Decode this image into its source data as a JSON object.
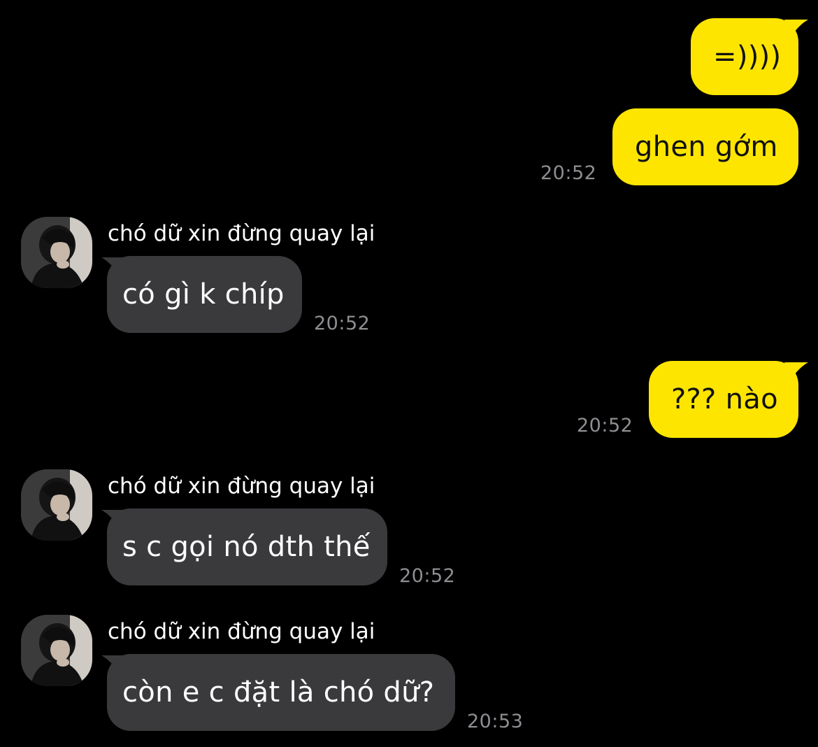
{
  "messages": [
    {
      "direction": "outgoing",
      "text": "=))))",
      "time": ""
    },
    {
      "direction": "outgoing",
      "text": "ghen gớm",
      "time": "20:52"
    },
    {
      "direction": "incoming",
      "sender": "chó dữ xin đừng quay lại",
      "text": "có gì k chíp",
      "time": "20:52",
      "avatar": "profile-photo-avatar"
    },
    {
      "direction": "outgoing",
      "text": "??? nào",
      "time": "20:52"
    },
    {
      "direction": "incoming",
      "sender": "chó dữ xin đừng quay lại",
      "text": "s c gọi nó dth thế",
      "time": "20:52",
      "avatar": "profile-photo-avatar"
    },
    {
      "direction": "incoming",
      "sender": "chó dữ xin đừng quay lại",
      "text": "còn e c đặt là chó dữ?",
      "time": "20:53",
      "avatar": "profile-photo-avatar"
    }
  ],
  "colors": {
    "background": "#000000",
    "outgoing_bubble": "#FEE500",
    "incoming_bubble": "#3a3a3c",
    "timestamp": "#8e8e93"
  }
}
